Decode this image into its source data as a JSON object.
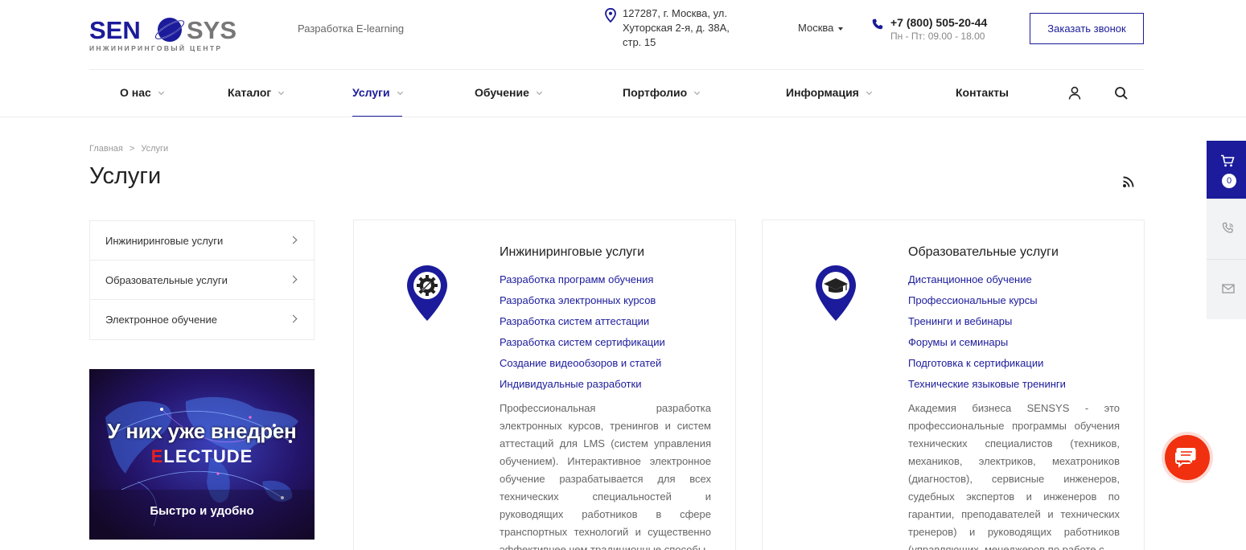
{
  "header": {
    "logo_text_left": "SEN",
    "logo_text_right": "SYS",
    "logo_subtitle": "ИНЖИНИРИНГОВЫЙ ЦЕНТР",
    "tagline": "Разработка E-learning",
    "address_line1": "127287, г. Москва, ул.",
    "address_line2": "Хуторская 2-я, д. 38А,",
    "address_line3": "стр. 15",
    "city": "Москва",
    "phone": "+7 (800) 505-20-44",
    "hours": "Пн - Пт: 09.00 - 18.00",
    "callback_label": "Заказать звонок"
  },
  "nav": {
    "items": [
      {
        "label": "О нас"
      },
      {
        "label": "Каталог"
      },
      {
        "label": "Услуги"
      },
      {
        "label": "Обучение"
      },
      {
        "label": "Портфолио"
      },
      {
        "label": "Информация"
      },
      {
        "label": "Контакты"
      }
    ]
  },
  "breadcrumb": {
    "home": "Главная",
    "separator": ">",
    "current": "Услуги"
  },
  "page_title": "Услуги",
  "sidebar": {
    "items": [
      {
        "label": "Инжиниринговые услуги"
      },
      {
        "label": "Образовательные услуги"
      },
      {
        "label": "Электронное обучение"
      }
    ]
  },
  "banner": {
    "line1": "У них уже внедрен",
    "line2_first": "E",
    "line2_rest": "LECTUDE",
    "line3": "Быстро и удобно"
  },
  "cards": [
    {
      "title": "Инжиниринговые услуги",
      "icon": "gear-wrench-icon",
      "links": [
        "Разработка программ обучения",
        "Разработка электронных курсов",
        "Разработка систем аттестации",
        "Разработка систем сертификации",
        "Создание видеообзоров и статей",
        "Индивидуальные разработки"
      ],
      "description": "Профессиональная разработка электронных курсов, тренингов и систем аттестаций для LMS (систем управления обучением). Интерактивное электронное обучение разрабатывается для всех технических специальностей и руководящих работников в сфере транспортных технологий и существенно эффективнее чем традиционные способы"
    },
    {
      "title": "Образовательные услуги",
      "icon": "graduation-cap-icon",
      "links": [
        "Дистанционное обучение",
        "Профессиональные курсы",
        "Тренинги и вебинары",
        "Форумы и семинары",
        "Подготовка к сертификации",
        "Технические языковые тренинги"
      ],
      "description": "Академия бизнеса SENSYS - это профессиональные программы обучения технических специалистов (техников, механиков, электриков, мехатроников (диагностов), сервисные инженеров, судебных экспертов и инженеров по гарантии, преподавателей и технических тренеров) и руководящих работников (управляющих, менеджеров по работе с"
    }
  ],
  "side_tabs": {
    "cart_count": "0"
  },
  "colors": {
    "brand": "#1b1b9b",
    "chat": "#f0300f"
  }
}
